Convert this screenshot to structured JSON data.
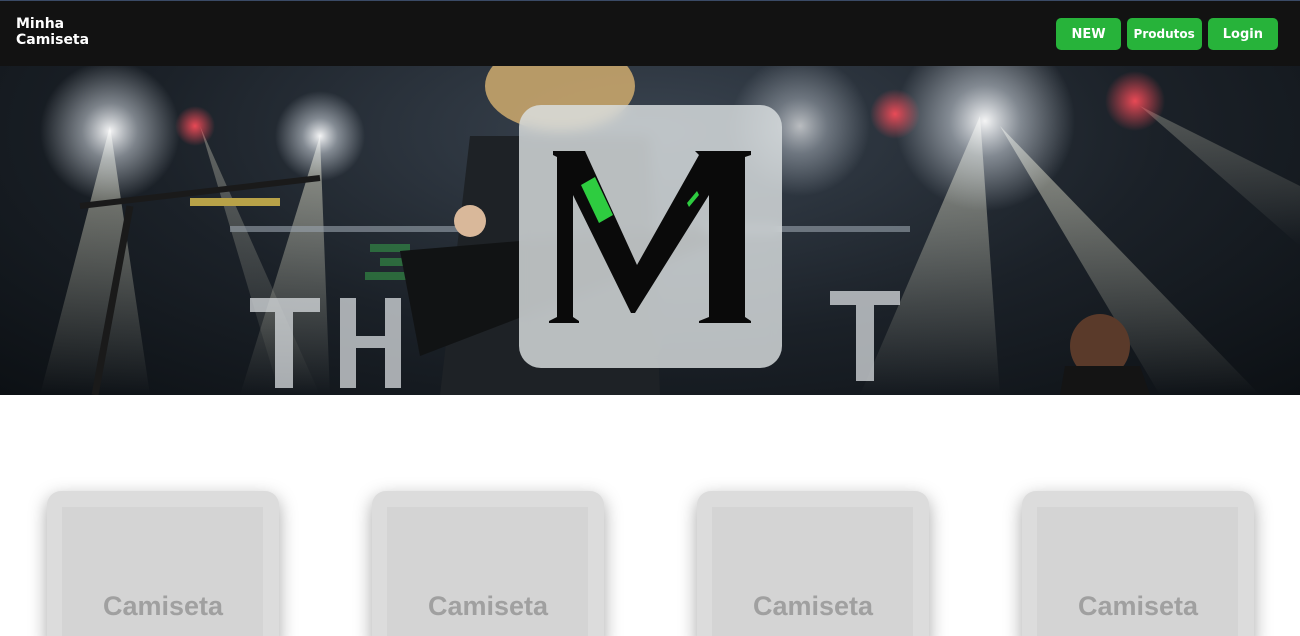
{
  "header": {
    "brand_line1": "Minha",
    "brand_line2": "Camiseta",
    "buttons": [
      {
        "label": "NEW"
      },
      {
        "label": "Produtos"
      },
      {
        "label": "Login"
      }
    ]
  },
  "hero": {
    "logo_letter": "M",
    "logo_accent_color": "#2ecc40"
  },
  "products": {
    "cards": [
      {
        "label": "Camiseta"
      },
      {
        "label": "Camiseta"
      },
      {
        "label": "Camiseta"
      },
      {
        "label": "Camiseta"
      }
    ]
  },
  "colors": {
    "header_bg": "#121212",
    "button_bg": "#27b33a",
    "card_text": "#a0a0a0"
  }
}
